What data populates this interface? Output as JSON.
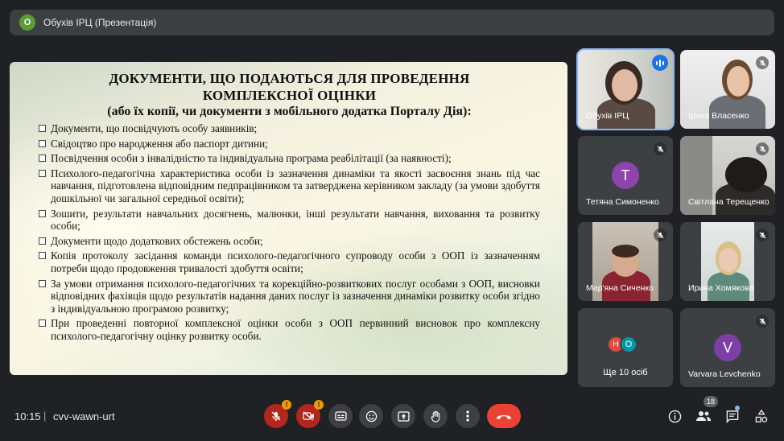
{
  "presenter_bar": {
    "avatar_letter": "О",
    "title": "Обухів ІРЦ (Презентація)"
  },
  "slide": {
    "title_line1": "ДОКУМЕНТИ, ЩО ПОДАЮТЬСЯ ДЛЯ ПРОВЕДЕННЯ",
    "title_line2": "КОМПЛЕКСНОЇ ОЦІНКИ",
    "subtitle": "(або їх копії, чи документи з мобільного додатка Порталу Дія):",
    "items": [
      "Документи, що посвідчують особу заявників;",
      "Свідоцтво про народження або паспорт дитини;",
      "Посвідчення особи з інвалідністю та індивідуальна програма реабілітації (за наявності);",
      "Психолого-педагогічна характеристика особи із зазначення динаміки та якості засвоєння знань під час навчання, підготовлена відповідним педпрацівником та затверджена керівником закладу (за умови здобуття дошкільної чи загальної середньої освіти);",
      "Зошити, результати навчальних досягнень, малюнки, інші результати навчання, виховання та розвитку особи;",
      "Документи щодо додаткових обстежень особи;",
      "Копія протоколу засідання команди психолого-педагогічного супроводу особи з ООП із зазначенням потреби щодо продовження тривалості здобуття освіти;",
      "За умови отримання психолого-педагогічних та корекційно-розвиткових послуг особами з ООП, висновки відповідних фахівців щодо результатів надання даних послуг із зазначення динаміки розвитку особи згідно з індивідуальною програмою розвитку;",
      "При проведенні повторної комплексної оцінки особи з ООП первинний висновок про комплексну психолого-педагогічну оцінку розвитку особи."
    ]
  },
  "participants": [
    {
      "name": "Обухів ІРЦ",
      "speaking": true
    },
    {
      "name": "Ірина Власенко",
      "muted": true
    },
    {
      "name": "Тетяна Симоненко",
      "letter": "Т",
      "muted": true,
      "color": "#8e44ad"
    },
    {
      "name": "Світлана Терещенко",
      "muted": true
    },
    {
      "name": "Мар'яна Сиченко",
      "muted": true
    },
    {
      "name": "Ирина Хомякова",
      "muted": true
    },
    {
      "name": "Varvara Levchenko",
      "letter": "V",
      "muted": true,
      "color": "#7b3fa6"
    }
  ],
  "more": {
    "label": "Ще 10 осіб",
    "avatars": [
      "Н",
      "О"
    ],
    "avatar_colors": [
      "#e8453c",
      "#0097a7"
    ]
  },
  "bottom": {
    "time": "10:15",
    "separator": "|",
    "meeting_code": "cvv-wawn-urt",
    "participant_count": "18",
    "warn": "!"
  },
  "colors": {
    "accent": "#8ab4f8",
    "hangup": "#ea4335",
    "tile": "#3c4043"
  }
}
